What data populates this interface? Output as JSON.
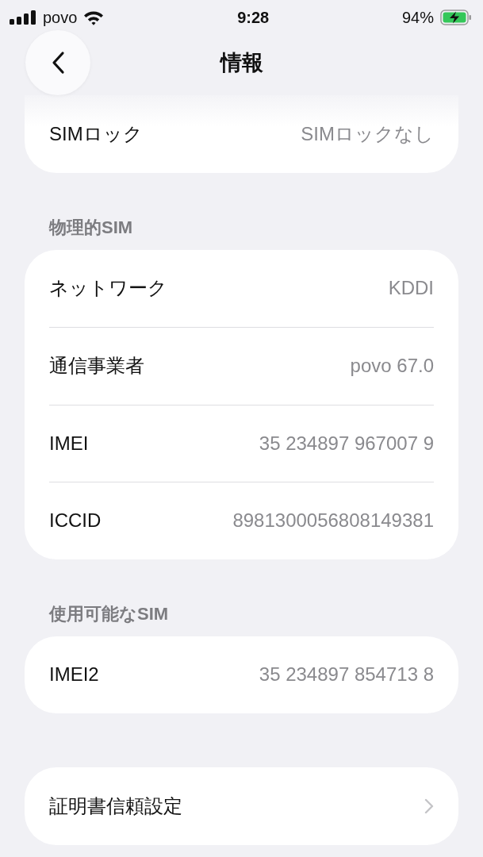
{
  "status_bar": {
    "carrier": "povo",
    "time": "9:28",
    "battery": "94%"
  },
  "title": "情報",
  "sections": [
    {
      "rows": [
        {
          "kind": "info",
          "label": "SIMロック",
          "value": "SIMロックなし"
        }
      ]
    },
    {
      "header": "物理的SIM",
      "rows": [
        {
          "kind": "info",
          "label": "ネットワーク",
          "value": "KDDI"
        },
        {
          "kind": "info",
          "label": "通信事業者",
          "value": "povo 67.0"
        },
        {
          "kind": "info",
          "label": "IMEI",
          "value": "35 234897 967007 9"
        },
        {
          "kind": "info",
          "label": "ICCID",
          "value": "8981300056808149381"
        }
      ]
    },
    {
      "header": "使用可能なSIM",
      "rows": [
        {
          "kind": "info",
          "label": "IMEI2",
          "value": "35 234897 854713 8"
        }
      ]
    },
    {
      "rows": [
        {
          "kind": "link",
          "label": "証明書信頼設定"
        }
      ]
    }
  ]
}
